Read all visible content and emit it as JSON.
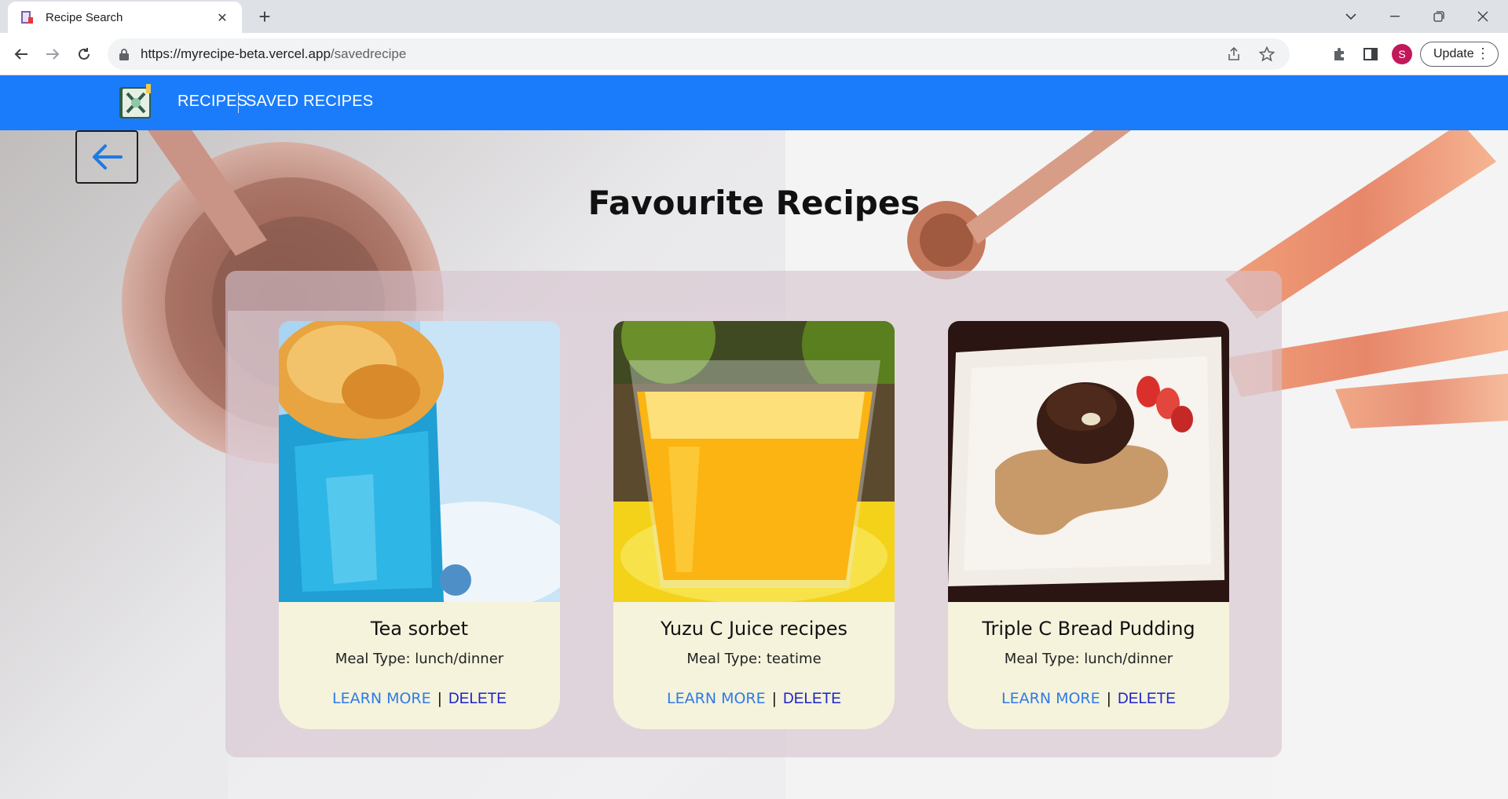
{
  "browser": {
    "tab_title": "Recipe Search",
    "tab_close": "✕",
    "new_tab": "+",
    "url_host": "https://myrecipe-beta.vercel.app",
    "url_path": "/savedrecipe",
    "avatar_letter": "S",
    "update_label": "Update"
  },
  "navbar": {
    "recipes_label": "RECIPES",
    "saved_label": "SAVED RECIPES"
  },
  "page": {
    "title": "Favourite Recipes"
  },
  "recipes": [
    {
      "name": "Tea sorbet",
      "meal_type": "Meal Type: lunch/dinner",
      "learn_label": "LEARN MORE",
      "separator": "|",
      "delete_label": "DELETE"
    },
    {
      "name": "Yuzu C Juice recipes",
      "meal_type": "Meal Type: teatime",
      "learn_label": "LEARN MORE",
      "separator": "|",
      "delete_label": "DELETE"
    },
    {
      "name": "Triple C Bread Pudding",
      "meal_type": "Meal Type: lunch/dinner",
      "learn_label": "LEARN MORE",
      "separator": "|",
      "delete_label": "DELETE"
    }
  ],
  "colors": {
    "navbar": "#1a7cfa",
    "card_bg": "#f5f3dc",
    "learn_link": "#2f7be6",
    "delete_link": "#1a22c8"
  }
}
